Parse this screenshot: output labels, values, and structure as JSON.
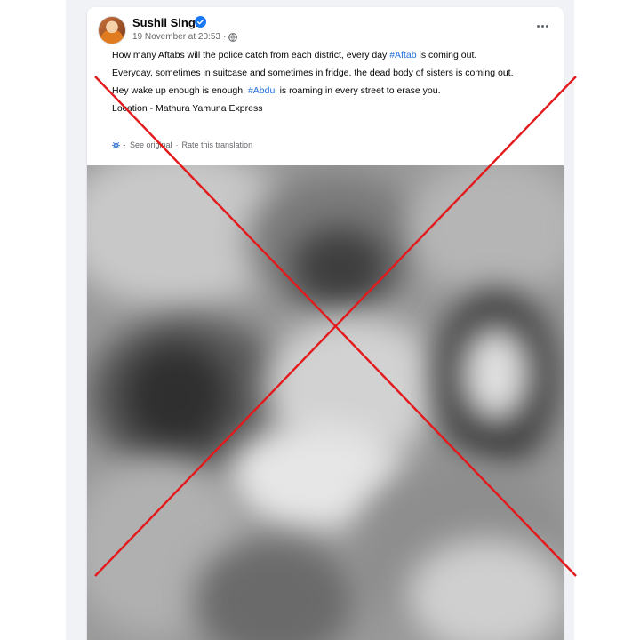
{
  "post": {
    "author": "Sushil Singh",
    "timestamp": "19 November at 20:53",
    "separator": "·",
    "paragraphs": {
      "p1_before": "How many Aftabs will the police catch from each district, every day ",
      "p1_hashtag": "#Aftab",
      "p1_after": " is coming out.",
      "p2": "Everyday, sometimes in suitcase and sometimes in fridge, the dead body of sisters is coming out.",
      "p3_before": "Hey wake up enough is enough, ",
      "p3_hashtag": "#Abdul",
      "p3_after": " is roaming in every street to erase you.",
      "p4": "Location - Mathura Yamuna Express"
    },
    "translation": {
      "see_original": "See original",
      "dot": "·",
      "rate": "Rate this translation"
    }
  },
  "icons": {
    "verified": "verified-badge-icon",
    "privacy": "globe-icon",
    "more": "more-options-icon",
    "translation": "gear-icon"
  },
  "colors": {
    "link": "#216fdb",
    "verified": "#1877f2",
    "cross": "#e3191c",
    "feed_background": "#f0f2f5"
  }
}
